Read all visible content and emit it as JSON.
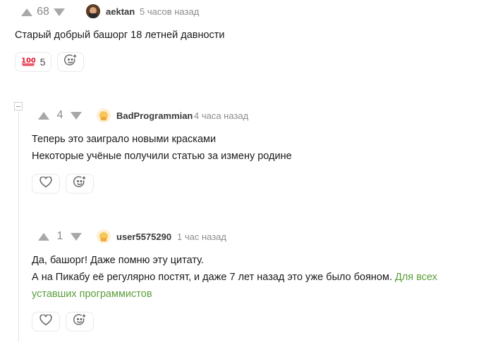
{
  "comments": [
    {
      "rating": "68",
      "author": "aektan",
      "time": "5 часов назад",
      "text": [
        "Старый добрый башорг 18 летней давности"
      ],
      "reactions": [
        {
          "emoji": "💯",
          "count": "5"
        }
      ]
    },
    {
      "rating": "4",
      "author": "BadProgrammian",
      "time": "4 часа назад",
      "text": [
        "Теперь это заиграло новыми красками",
        "Некоторые учёные получили статью за измену родине"
      ]
    },
    {
      "rating": "1",
      "author": "user5575290",
      "time": "1 час назад",
      "text": [
        "Да, башорг! Даже помню эту цитату.",
        "А на Пикабу её регулярно постят, и даже 7 лет назад это уже было бояном."
      ],
      "link_text_1": "Для всех",
      "link_text_2": "уставших программистов"
    }
  ],
  "colors": {
    "accent_link": "#5a9e3a",
    "vote_arrow": "#a8a8a8",
    "thread_line": "#e4e4e4"
  },
  "icons": [
    "upvote-arrow",
    "downvote-arrow",
    "heart-icon",
    "add-reaction-icon",
    "hundred-points-emoji"
  ]
}
